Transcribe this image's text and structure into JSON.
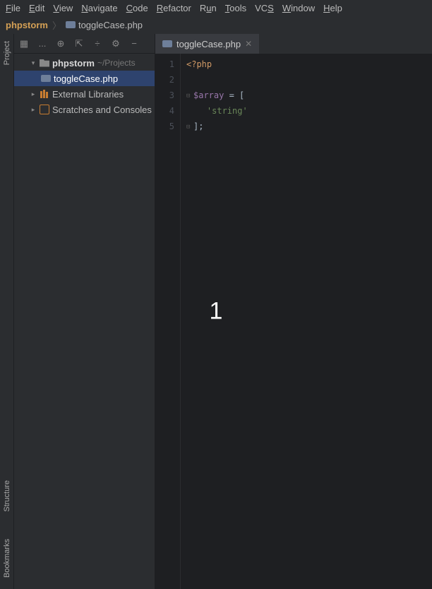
{
  "menubar": {
    "file": "File",
    "edit": "Edit",
    "view": "View",
    "navigate": "Navigate",
    "code": "Code",
    "refactor": "Refactor",
    "run": "Run",
    "tools": "Tools",
    "vcs": "VCS",
    "window": "Window",
    "help": "Help"
  },
  "breadcrumb": {
    "root": "phpstorm",
    "file": "toggleCase.php"
  },
  "rail": {
    "project": "Project",
    "structure": "Structure",
    "bookmarks": "Bookmarks"
  },
  "toolbar": {
    "select_opened": "...",
    "target": "⊕",
    "expand": "⇱",
    "collapse": "÷",
    "settings": "⚙",
    "hide": "−"
  },
  "tree": {
    "project_name": "phpstorm",
    "project_path": "~/Projects",
    "file1": "toggleCase.php",
    "ext_libs": "External Libraries",
    "scratches": "Scratches and Consoles"
  },
  "tabs": {
    "t1": "toggleCase.php"
  },
  "gutter": {
    "l1": "1",
    "l2": "2",
    "l3": "3",
    "l4": "4",
    "l5": "5"
  },
  "code": {
    "l1_tag": "<?php",
    "l3_var": "$array",
    "l3_rest": " = [",
    "l4_indent": "    ",
    "l4_str": "'string'",
    "l5": "];"
  },
  "overlay": "1"
}
